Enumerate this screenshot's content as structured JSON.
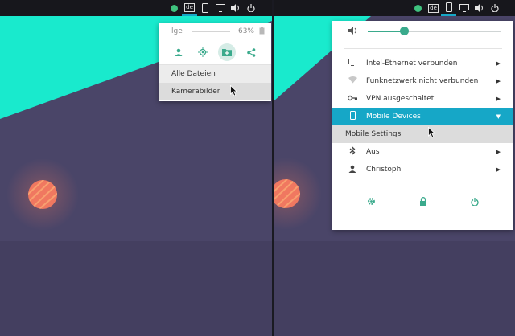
{
  "colors": {
    "accent": "#16a7c7",
    "teal": "#3aaa8c",
    "wallpaper_cyan": "#19eacd",
    "wallpaper_purple": "#4a4568",
    "sun": "#f07860",
    "panel": "#17171c"
  },
  "left_screen": {
    "tray_icons": [
      "green-status-icon",
      "keyboard-layout-icon",
      "phone-icon",
      "display-icon",
      "volume-icon",
      "power-icon"
    ],
    "keyboard_label": "de",
    "popup": {
      "battery_label": "lge",
      "battery_percent": "63%",
      "battery_level": 0.63,
      "share_actions": [
        "person-icon",
        "location-icon",
        "folder-icon",
        "share-icon"
      ],
      "menu_items": [
        "Alle Dateien",
        "Kamerabilder"
      ]
    }
  },
  "right_screen": {
    "tray_icons": [
      "green-status-icon",
      "keyboard-layout-icon",
      "phone-icon",
      "display-icon",
      "volume-icon",
      "power-icon"
    ],
    "keyboard_label": "de",
    "popup": {
      "volume_level": 0.27,
      "items": [
        {
          "icon": "ethernet-icon",
          "label": "Intel-Ethernet verbunden"
        },
        {
          "icon": "wifi-icon",
          "label": "Funknetzwerk nicht verbunden"
        },
        {
          "icon": "vpn-key-icon",
          "label": "VPN ausgeschaltet"
        },
        {
          "icon": "phone-icon",
          "label": "Mobile Devices"
        }
      ],
      "submenu_item": "Mobile Settings",
      "bluetooth_label": "Aus",
      "user_label": "Christoph",
      "bottom_actions": [
        "settings-icon",
        "lock-icon",
        "power-icon"
      ]
    }
  }
}
